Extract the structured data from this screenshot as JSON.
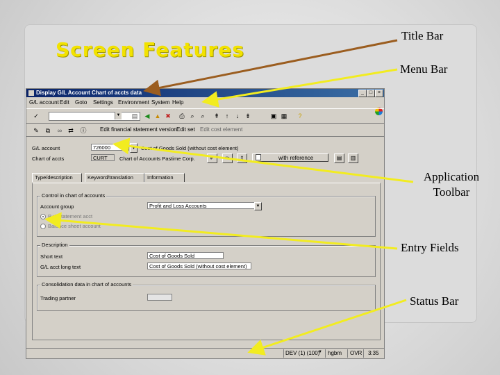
{
  "slide": {
    "title": "Screen Features"
  },
  "callouts": {
    "title_bar": "Title Bar",
    "menu_bar": "Menu Bar",
    "application_toolbar": [
      "Application",
      "Toolbar"
    ],
    "entry_fields": "Entry Fields",
    "status_bar": "Status Bar"
  },
  "colors": {
    "title_arrow": "#9b5d1f",
    "other_arrows": "#f2ec20",
    "slide_title": "#f2e200"
  },
  "window": {
    "title": "Display G/L Account Chart of accts data",
    "menu": [
      "G/L account",
      "Edit",
      "Goto",
      "Settings",
      "Environment",
      "System",
      "Help"
    ],
    "app_toolbar": {
      "edit_label": "Edit financial statement version",
      "edit_set": "Edit set",
      "edit_cost": "Edit cost element"
    }
  },
  "header_fields": {
    "gl_account_label": "G/L account",
    "gl_account_value": "726000",
    "gl_account_desc": "Cost of Goods Sold (without cost element)",
    "chart_label": "Chart of accts",
    "chart_value": "CURT",
    "chart_desc": "Chart of Accounts Pastime Corp.",
    "ref_button": "with reference"
  },
  "tabs": [
    "Type/description",
    "Keyword/translation",
    "Information"
  ],
  "control_group": {
    "title": "Control in chart of accounts",
    "account_group_label": "Account group",
    "account_group_value": "Profit and Loss Accounts",
    "radio_pl": "P+L statement acct",
    "radio_bs": "Balance sheet account"
  },
  "description_group": {
    "title": "Description",
    "short_text_label": "Short text",
    "short_text_value": "Cost of Goods Sold",
    "long_text_label": "G/L acct long text",
    "long_text_value": "Cost of Goods Sold (without cost element)"
  },
  "consolidation_group": {
    "title": "Consolidation data in chart of accounts",
    "trading_partner_label": "Trading partner"
  },
  "status": {
    "system": "DEV (1) (100)",
    "host": "hgbm",
    "mode": "OVR",
    "time": "3:35"
  }
}
